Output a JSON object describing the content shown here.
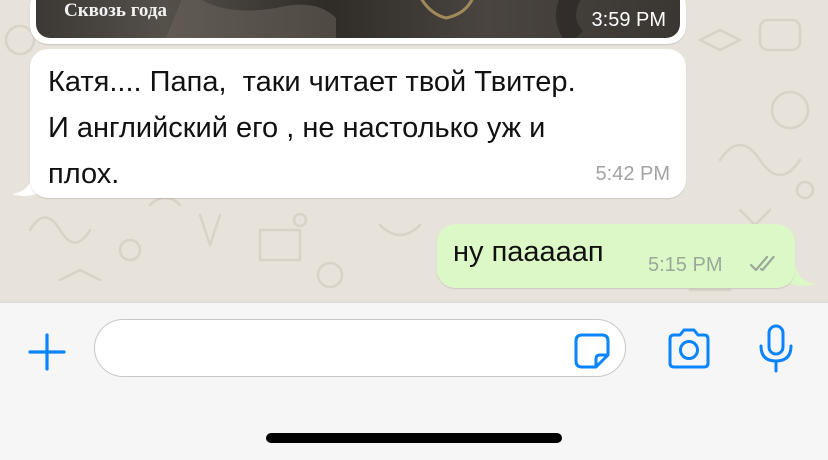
{
  "colors": {
    "accent": "#0a84ff",
    "incoming_bubble": "#ffffff",
    "outgoing_bubble": "#dcf8c6",
    "chat_background": "#e7e2da",
    "timestamp_gray": "#a3a3a3"
  },
  "media_message": {
    "caption": "Сквозь года",
    "time": "3:59 PM"
  },
  "incoming_message": {
    "text": "Катя.... Папа,  таки читает твой Твитер.\nИ английский его , не настолько уж и\nплох.",
    "time": "5:42 PM"
  },
  "outgoing_message": {
    "text": "ну пааааап",
    "time": "5:15 PM",
    "status_icon": "double-check-icon"
  },
  "composer": {
    "attach_icon": "plus-icon",
    "input_value": "",
    "sticker_icon": "sticker-icon",
    "camera_icon": "camera-icon",
    "mic_icon": "microphone-icon"
  }
}
